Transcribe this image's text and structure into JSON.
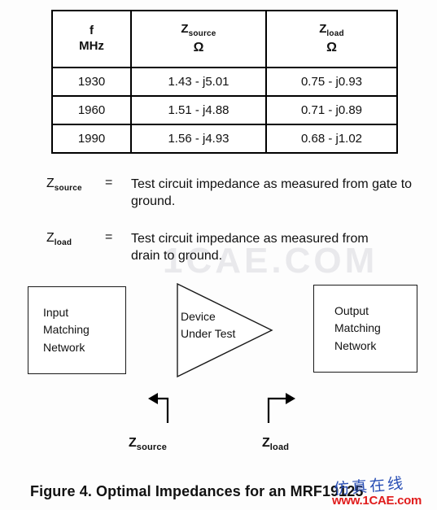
{
  "background_watermark": "1CAE.COM",
  "table": {
    "columns": [
      {
        "symbol": "f",
        "sub": "",
        "unit": "MHz"
      },
      {
        "symbol": "Z",
        "sub": "source",
        "unit": "Ω"
      },
      {
        "symbol": "Z",
        "sub": "load",
        "unit": "Ω"
      }
    ],
    "rows": [
      {
        "f": "1930",
        "z_source": "1.43  -  j5.01",
        "z_load": "0.75  -  j0.93"
      },
      {
        "f": "1960",
        "z_source": "1.51  -  j4.88",
        "z_load": "0.71  -  j0.89"
      },
      {
        "f": "1990",
        "z_source": "1.56  -  j4.93",
        "z_load": "0.68  -  j1.02"
      }
    ]
  },
  "definitions": [
    {
      "symbol": "Z",
      "subscript": "source",
      "equals": "=",
      "text": "Test circuit impedance as measured from gate to ground."
    },
    {
      "symbol": "Z",
      "subscript": "load",
      "equals": "=",
      "text": "Test circuit impedance as measured from drain to ground."
    }
  ],
  "diagram": {
    "input_block": "Input\nMatching\nNetwork",
    "dut_block": "Device\nUnder Test",
    "output_block": "Output\nMatching\nNetwork",
    "source_label": {
      "symbol": "Z",
      "subscript": "source"
    },
    "load_label": {
      "symbol": "Z",
      "subscript": "load"
    }
  },
  "caption": "Figure 4.  Optimal Impedances for an MRF19125",
  "watermark": {
    "chinese": "仿真在线",
    "url": "www.1CAE.com",
    "chinese_color": "#2a4fb5",
    "url_color": "#e01b1b"
  }
}
